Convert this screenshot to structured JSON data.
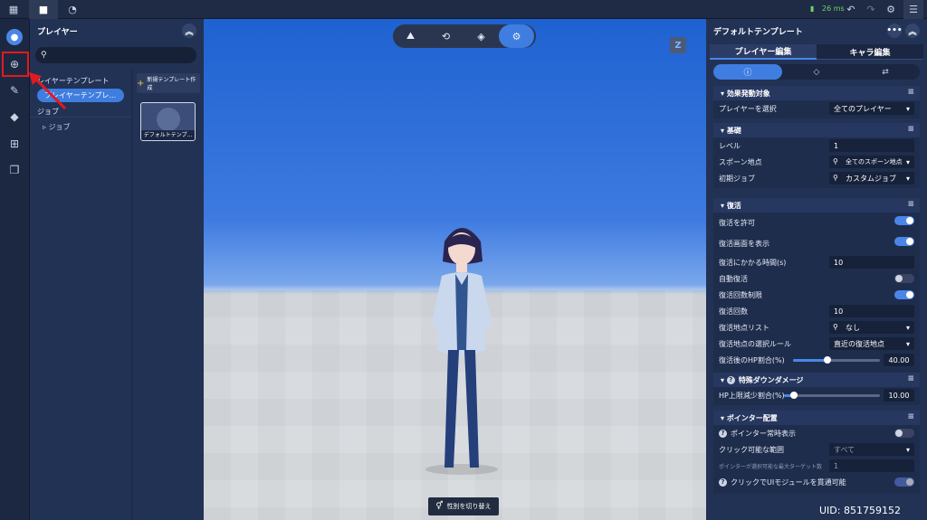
{
  "topbar": {
    "ping": "26 ms",
    "icons": [
      "apps-grid-icon",
      "folder-icon",
      "dashboard-icon",
      "signal-icon",
      "undo-icon",
      "redo-icon",
      "settings-icon",
      "sliders-icon"
    ]
  },
  "rail": {
    "icons": [
      "avatar-icon",
      "target-add-icon",
      "syringe-icon",
      "tag-icon",
      "tray-add-icon",
      "layers-icon"
    ]
  },
  "left_panel": {
    "title": "プレイヤー",
    "search_placeholder": "",
    "tree": {
      "category_template": "レイヤーテンプレート",
      "selected_item": "プレイヤーテンプレ...",
      "category_job": "ジョブ",
      "sub_job": "ジョブ"
    },
    "new_template_label": "新規テンプレート作成",
    "card_label": "デフォルトテンプ..."
  },
  "viewport": {
    "tools": [
      "terrain-icon",
      "cube-rotate-icon",
      "cube-icon",
      "gear-target-icon"
    ],
    "z_badge": "Z",
    "gender_button": "性別を切り替え",
    "uid": "UID: 851759152"
  },
  "right_panel": {
    "title": "デフォルトテンプレート",
    "tabs": [
      "プレイヤー編集",
      "キャラ編集"
    ],
    "subtabs": [
      "info-icon",
      "shapes-icon",
      "transfer-icon"
    ],
    "sections": {
      "effect_target": {
        "title": "効果発動対象",
        "player_select_label": "プレイヤーを選択",
        "player_select_value": "全てのプレイヤー"
      },
      "basic": {
        "title": "基礎",
        "level_label": "レベル",
        "level_value": "1",
        "spawn_label": "スポーン地点",
        "spawn_value": "全てのスポーン地点",
        "job_label": "初期ジョブ",
        "job_value": "カスタムジョブ"
      },
      "revive": {
        "title": "復活",
        "allow_label": "復活を許可",
        "screen_label": "復活画面を表示",
        "time_label": "復活にかかる時間(s)",
        "time_value": "10",
        "auto_label": "自動復活",
        "limit_label": "復活回数制限",
        "count_label": "復活回数",
        "count_value": "10",
        "points_label": "復活地点リスト",
        "points_value": "なし",
        "rule_label": "復活地点の選択ルール",
        "rule_value": "直近の復活地点",
        "hp_label": "復活後のHP割合(%)",
        "hp_value": "40.00",
        "hp_fraction": 0.4
      },
      "special_damage": {
        "title": "特殊ダウンダメージ",
        "hp_reduce_label": "HP上限減少割合(%)",
        "hp_reduce_value": "10.00",
        "hp_reduce_fraction": 0.1
      },
      "pointer": {
        "title": "ポインター配置",
        "always_label": "ポインター常時表示",
        "range_label": "クリック可能な範囲",
        "range_value": "すべて",
        "max_targets_label": "ポインターが選択可能な最大ターゲット数",
        "max_targets_value": "1",
        "ui_click_label": "クリックでUIモジュールを貫通可能"
      }
    }
  }
}
